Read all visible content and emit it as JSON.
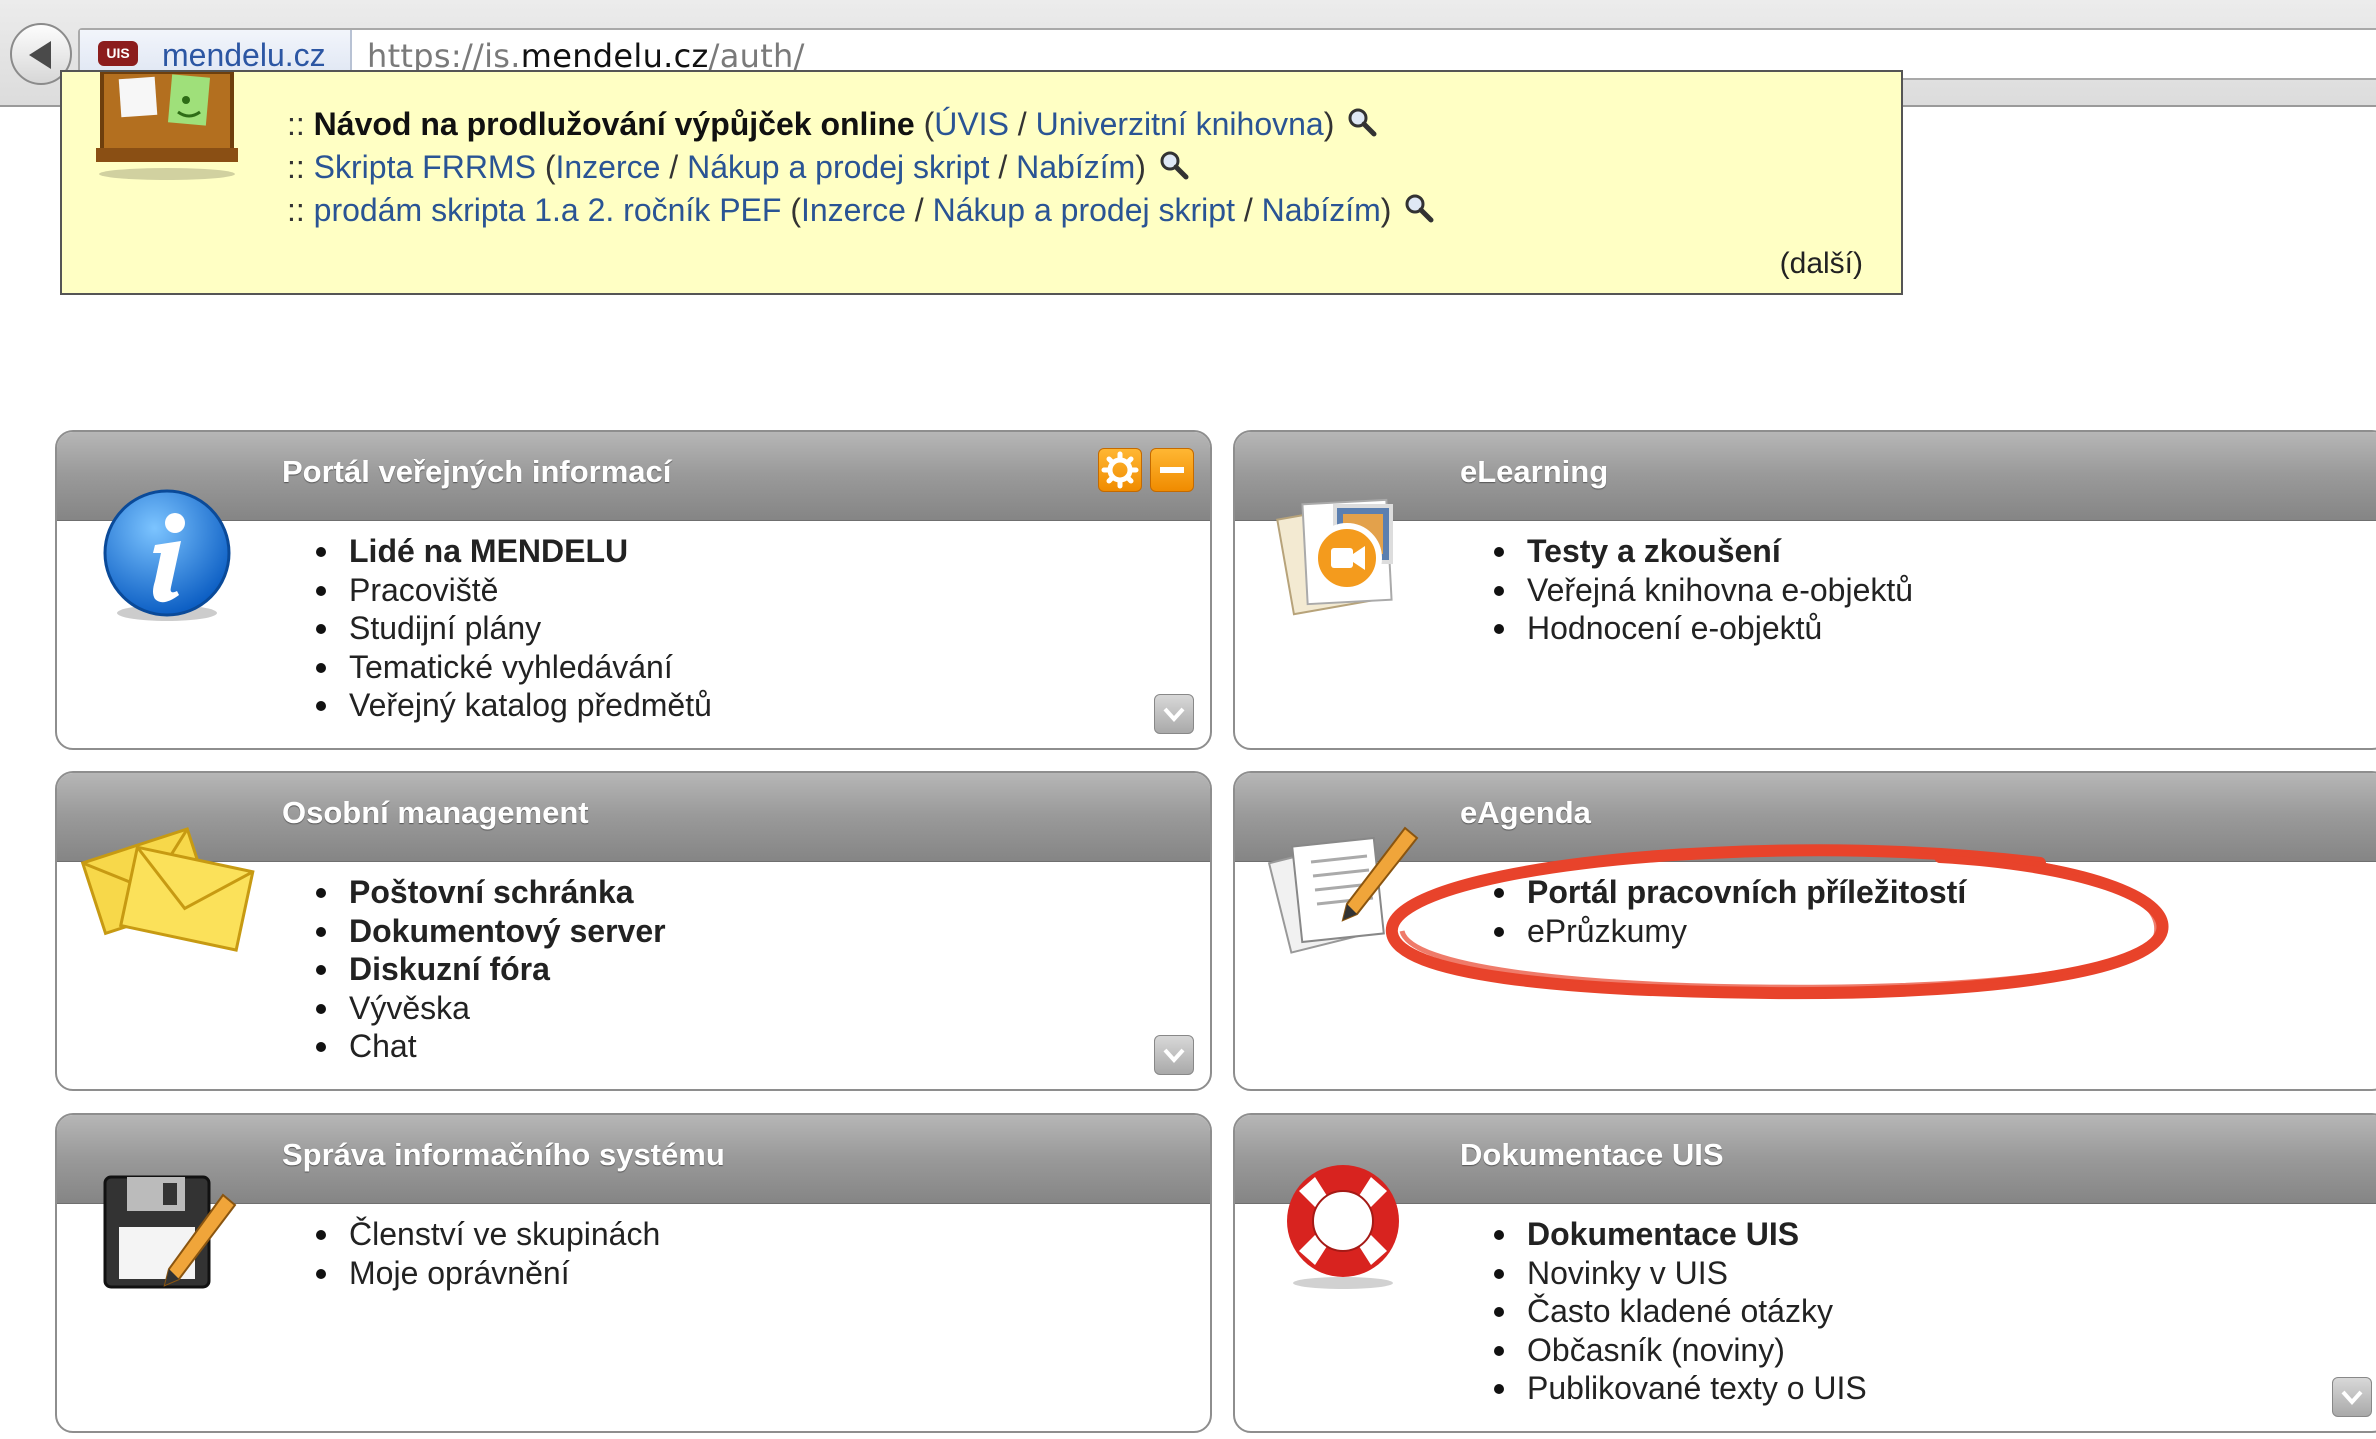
{
  "browser": {
    "identity": "mendelu.cz",
    "uis_badge": "UIS",
    "url_scheme": "https://is.",
    "url_domain": "mendelu.cz",
    "url_path": "/auth/"
  },
  "notices": {
    "items": [
      {
        "prefix": "::",
        "title": "Návod na prodlužování výpůjček online",
        "bold": true,
        "open": "(",
        "cat1": "ÚVIS",
        "sep1": "/",
        "cat2": "Univerzitní knihovna",
        "close": ")"
      },
      {
        "prefix": "::",
        "title": "Skripta FRRMS",
        "bold": false,
        "open": "(",
        "cat1": "Inzerce",
        "sep1": "/",
        "cat2": "Nákup a prodej skript",
        "sep2": "/",
        "cat3": "Nabízím",
        "close": ")"
      },
      {
        "prefix": "::",
        "title": "prodám skripta 1.a 2. ročník PEF",
        "bold": false,
        "open": "(",
        "cat1": "Inzerce",
        "sep1": "/",
        "cat2": "Nákup a prodej skript",
        "sep2": "/",
        "cat3": "Nabízím",
        "close": ")"
      }
    ],
    "more": "(další)"
  },
  "panels": {
    "public": {
      "title": "Portál veřejných informací",
      "items": [
        "Lidé na MENDELU",
        "Pracoviště",
        "Studijní plány",
        "Tematické vyhledávání",
        "Veřejný katalog předmětů"
      ]
    },
    "elearning": {
      "title": "eLearning",
      "items": [
        "Testy a zkoušení",
        "Veřejná knihovna e-objektů",
        "Hodnocení e-objektů"
      ]
    },
    "personal": {
      "title": "Osobní management",
      "items": [
        "Poštovní schránka",
        "Dokumentový server",
        "Diskuzní fóra",
        "Vývěska",
        "Chat"
      ]
    },
    "eagenda": {
      "title": "eAgenda",
      "items": [
        "Portál pracovních příležitostí",
        "ePrůzkumy"
      ]
    },
    "admin": {
      "title": "Správa informačního systému",
      "items": [
        "Členství ve skupinách",
        "Moje oprávnění"
      ]
    },
    "docs": {
      "title": "Dokumentace UIS",
      "items": [
        "Dokumentace UIS",
        "Novinky v UIS",
        "Často kladené otázky",
        "Občasník (noviny)",
        "Publikované texty o UIS"
      ]
    }
  },
  "colors": {
    "link": "#2a5494",
    "notice_bg": "#ffffc4",
    "header_gray": "#9a9a9a",
    "accent_orange": "#f39a0e",
    "highlight_red": "#e8432b"
  }
}
